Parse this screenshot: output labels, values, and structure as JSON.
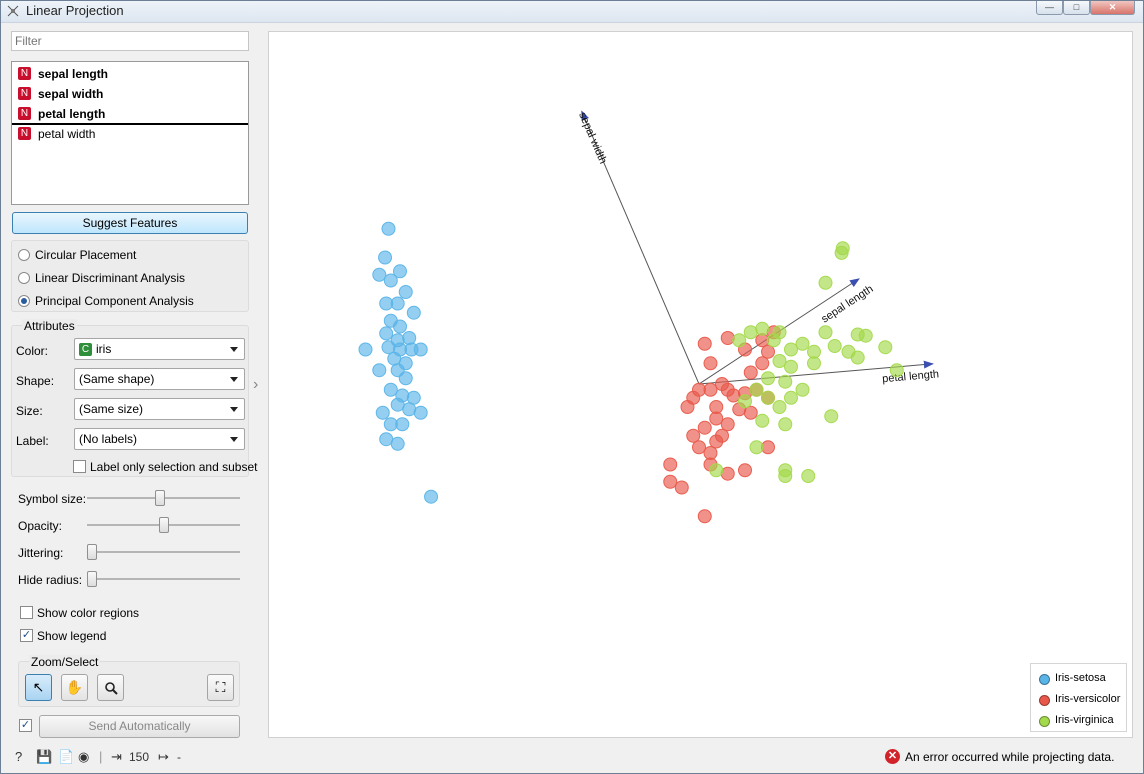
{
  "window": {
    "title": "Linear Projection"
  },
  "filter": {
    "placeholder": "Filter"
  },
  "attributes": {
    "items": [
      {
        "badge": "N",
        "label": "sepal length",
        "bold": true
      },
      {
        "badge": "N",
        "label": "sepal width",
        "bold": true
      },
      {
        "badge": "N",
        "label": "petal length",
        "bold": true
      },
      {
        "badge": "N",
        "label": "petal width",
        "bold": false
      }
    ]
  },
  "suggest_button": {
    "label": "Suggest Features"
  },
  "placement": {
    "options": [
      "Circular Placement",
      "Linear Discriminant Analysis",
      "Principal Component Analysis"
    ],
    "selected": "Principal Component Analysis"
  },
  "attributes_box": {
    "title": "Attributes",
    "color": {
      "label": "Color:",
      "value": "iris",
      "badge": "C"
    },
    "shape": {
      "label": "Shape:",
      "value": "(Same shape)"
    },
    "size": {
      "label": "Size:",
      "value": "(Same size)"
    },
    "label": {
      "label": "Label:",
      "value": "(No labels)"
    },
    "label_only": {
      "label": "Label only selection and subset",
      "checked": false
    }
  },
  "sliders": {
    "symbol_size": {
      "label": "Symbol size:",
      "value": 0.47
    },
    "opacity": {
      "label": "Opacity:",
      "value": 0.5
    },
    "jittering": {
      "label": "Jittering:",
      "value": 0.0
    },
    "hide_radius": {
      "label": "Hide radius:",
      "value": 0.0
    }
  },
  "options": {
    "show_color_regions": {
      "label": "Show color regions",
      "checked": false
    },
    "show_legend": {
      "label": "Show legend",
      "checked": true
    }
  },
  "zoom_select": {
    "title": "Zoom/Select",
    "tools": [
      "pointer-icon",
      "pan-hand-icon",
      "zoom-icon",
      "fit-view-icon"
    ]
  },
  "send": {
    "label": "Send Automatically",
    "auto": true
  },
  "status": {
    "count": "150",
    "output": "-",
    "error": "An error occurred while projecting data."
  },
  "colors": {
    "setosa": "#5ab4e8",
    "versicolor": "#e8584a",
    "virginica": "#a3d94a"
  },
  "chart_data": {
    "type": "scatter",
    "title": "",
    "legend": {
      "placement": "bottom-right",
      "entries": [
        "Iris-setosa",
        "Iris-versicolor",
        "Iris-virginica"
      ]
    },
    "axes": [
      {
        "name": "sepal width",
        "dx": -0.43,
        "dy": 1.0
      },
      {
        "name": "sepal length",
        "dx": 0.73,
        "dy": 0.48
      },
      {
        "name": "petal length",
        "dx": 0.81,
        "dy": 0.07
      }
    ],
    "xlim": [
      -4,
      4
    ],
    "ylim": [
      -2.5,
      3.5
    ],
    "series": [
      {
        "name": "Iris-setosa",
        "points": [
          [
            -2.7,
            1.35
          ],
          [
            -2.73,
            1.1
          ],
          [
            -2.78,
            0.95
          ],
          [
            -2.68,
            0.9
          ],
          [
            -2.6,
            0.98
          ],
          [
            -2.55,
            0.8
          ],
          [
            -2.72,
            0.7
          ],
          [
            -2.62,
            0.7
          ],
          [
            -2.48,
            0.62
          ],
          [
            -2.68,
            0.55
          ],
          [
            -2.6,
            0.5
          ],
          [
            -2.72,
            0.44
          ],
          [
            -2.62,
            0.38
          ],
          [
            -2.52,
            0.4
          ],
          [
            -2.9,
            0.3
          ],
          [
            -2.7,
            0.32
          ],
          [
            -2.6,
            0.3
          ],
          [
            -2.5,
            0.3
          ],
          [
            -2.42,
            0.3
          ],
          [
            -2.65,
            0.22
          ],
          [
            -2.55,
            0.18
          ],
          [
            -2.78,
            0.12
          ],
          [
            -2.62,
            0.12
          ],
          [
            -2.55,
            0.05
          ],
          [
            -2.68,
            -0.05
          ],
          [
            -2.58,
            -0.1
          ],
          [
            -2.48,
            -0.12
          ],
          [
            -2.62,
            -0.18
          ],
          [
            -2.52,
            -0.22
          ],
          [
            -2.42,
            -0.25
          ],
          [
            -2.75,
            -0.25
          ],
          [
            -2.68,
            -0.35
          ],
          [
            -2.58,
            -0.35
          ],
          [
            -2.72,
            -0.48
          ],
          [
            -2.62,
            -0.52
          ],
          [
            -2.33,
            -0.98
          ]
        ]
      },
      {
        "name": "Iris-versicolor",
        "points": [
          [
            0.05,
            0.35
          ],
          [
            0.25,
            0.4
          ],
          [
            0.55,
            0.38
          ],
          [
            0.65,
            0.45
          ],
          [
            0.4,
            0.3
          ],
          [
            0.6,
            0.28
          ],
          [
            0.1,
            0.18
          ],
          [
            0.55,
            0.18
          ],
          [
            0.45,
            0.1
          ],
          [
            0.2,
            0.0
          ],
          [
            0.25,
            -0.05
          ],
          [
            0.3,
            -0.1
          ],
          [
            0.4,
            -0.08
          ],
          [
            0.5,
            -0.05
          ],
          [
            0.1,
            -0.05
          ],
          [
            -0.05,
            -0.12
          ],
          [
            0.0,
            -0.05
          ],
          [
            0.6,
            -0.12
          ],
          [
            -0.1,
            -0.2
          ],
          [
            0.15,
            -0.2
          ],
          [
            0.35,
            -0.22
          ],
          [
            0.45,
            -0.25
          ],
          [
            0.15,
            -0.3
          ],
          [
            0.25,
            -0.35
          ],
          [
            0.05,
            -0.38
          ],
          [
            0.2,
            -0.45
          ],
          [
            -0.05,
            -0.45
          ],
          [
            0.15,
            -0.5
          ],
          [
            0.0,
            -0.55
          ],
          [
            0.6,
            -0.55
          ],
          [
            0.1,
            -0.6
          ],
          [
            -0.25,
            -0.7
          ],
          [
            0.1,
            -0.7
          ],
          [
            0.4,
            -0.75
          ],
          [
            0.25,
            -0.78
          ],
          [
            -0.25,
            -0.85
          ],
          [
            -0.15,
            -0.9
          ],
          [
            0.05,
            -1.15
          ]
        ]
      },
      {
        "name": "Iris-virginica",
        "points": [
          [
            1.25,
            1.18
          ],
          [
            1.24,
            1.14
          ],
          [
            1.1,
            0.88
          ],
          [
            0.45,
            0.45
          ],
          [
            0.55,
            0.48
          ],
          [
            0.7,
            0.45
          ],
          [
            1.1,
            0.45
          ],
          [
            1.38,
            0.43
          ],
          [
            1.45,
            0.42
          ],
          [
            0.35,
            0.38
          ],
          [
            0.65,
            0.38
          ],
          [
            0.9,
            0.35
          ],
          [
            1.18,
            0.33
          ],
          [
            1.62,
            0.32
          ],
          [
            0.8,
            0.3
          ],
          [
            1.0,
            0.28
          ],
          [
            1.3,
            0.28
          ],
          [
            1.38,
            0.23
          ],
          [
            0.7,
            0.2
          ],
          [
            1.0,
            0.18
          ],
          [
            1.72,
            0.12
          ],
          [
            0.8,
            0.15
          ],
          [
            0.6,
            0.05
          ],
          [
            0.75,
            0.02
          ],
          [
            0.5,
            -0.05
          ],
          [
            0.9,
            -0.05
          ],
          [
            0.6,
            -0.12
          ],
          [
            0.8,
            -0.12
          ],
          [
            0.4,
            -0.15
          ],
          [
            0.7,
            -0.2
          ],
          [
            1.15,
            -0.28
          ],
          [
            0.55,
            -0.32
          ],
          [
            0.75,
            -0.35
          ],
          [
            0.5,
            -0.55
          ],
          [
            0.75,
            -0.75
          ],
          [
            0.15,
            -0.75
          ],
          [
            0.95,
            -0.8
          ],
          [
            0.75,
            -0.8
          ]
        ]
      }
    ]
  }
}
